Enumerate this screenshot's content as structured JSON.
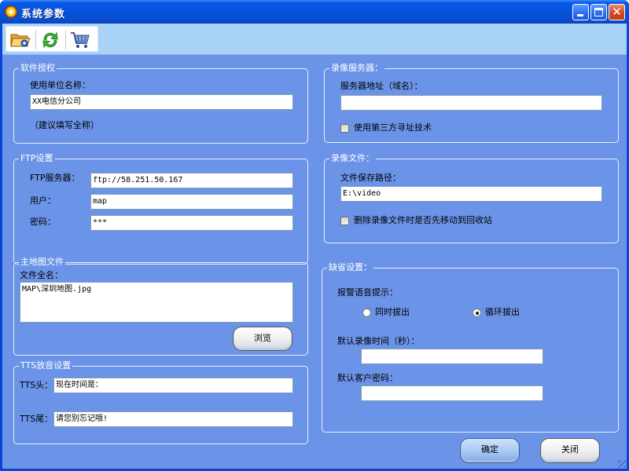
{
  "window": {
    "title": "系统参数",
    "min_label": "",
    "max_label": "",
    "close_label": "✕"
  },
  "toolbar": {
    "icons": [
      "folder-open-icon",
      "refresh-icon",
      "shopping-cart-icon"
    ]
  },
  "license": {
    "group_title": "软件授权",
    "unit_label": "使用单位名称：",
    "unit_value": "XX电信分公司",
    "hint": "（建议填写全称）"
  },
  "ftp": {
    "group_title": "FTP设置",
    "server_label": "FTP服务器：",
    "server_value": "ftp://58.251.50.167",
    "user_label": "用户：",
    "user_value": "map",
    "password_label": "密码：",
    "password_value": "***"
  },
  "map": {
    "group_title": "主地图文件",
    "file_label": "文件全名：",
    "file_value": "MAP\\深圳地图.jpg",
    "browse_label": "浏览"
  },
  "tts": {
    "group_title": "TTS放音设置",
    "head_label": "TTS头：",
    "head_value": "现在时间是：",
    "tail_label": "TTS尾：",
    "tail_value": "请您别忘记哦!"
  },
  "record_server": {
    "group_title": "录像服务器：",
    "address_label": "服务器地址（域名）：",
    "address_value": "",
    "third_party_label": "使用第三方寻址技术",
    "third_party_checked": false
  },
  "record_file": {
    "group_title": "录像文件：",
    "path_label": "文件保存路径：",
    "path_value": "E:\\video",
    "recycle_label": "删除录像文件时是否先移动到回收站",
    "recycle_checked": false
  },
  "defaults": {
    "group_title": "缺省设置：",
    "alarm_label": "报警语音提示：",
    "option_simultaneous": "同时拔出",
    "option_loop": "循环拔出",
    "selected_option": "循环拔出",
    "record_time_label": "默认录像时间（秒）：",
    "record_time_value": "",
    "client_password_label": "默认客户密码：",
    "client_password_value": ""
  },
  "actions": {
    "ok_label": "确定",
    "close_label": "关闭"
  },
  "colors": {
    "titlebar": "#0553d8",
    "client": "#6b94e8",
    "toolbar": "#a9d3f6",
    "close_button": "#d8481e"
  }
}
